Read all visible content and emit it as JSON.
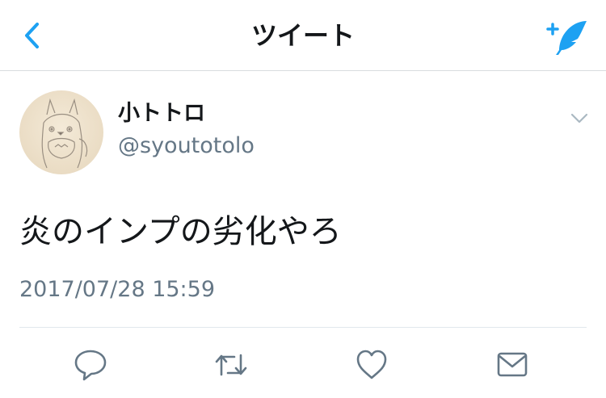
{
  "header": {
    "title": "ツイート",
    "back_icon": "chevron-left-icon",
    "compose_icon": "compose-feather-icon",
    "accent_color": "#1da1f2"
  },
  "tweet": {
    "author": {
      "display_name": "小トトロ",
      "handle": "@syoutotolo",
      "avatar": "totoro-sketch-avatar"
    },
    "text": "炎のインプの劣化やろ",
    "timestamp": "2017/07/28 15:59",
    "more_icon": "chevron-down-icon"
  },
  "actions": [
    {
      "name": "reply",
      "icon": "reply-icon"
    },
    {
      "name": "retweet",
      "icon": "retweet-icon"
    },
    {
      "name": "like",
      "icon": "heart-icon"
    },
    {
      "name": "share",
      "icon": "mail-icon"
    }
  ],
  "colors": {
    "text": "#14171a",
    "secondary": "#657786",
    "divider": "#e1e8ed",
    "action_icon": "#657786"
  }
}
